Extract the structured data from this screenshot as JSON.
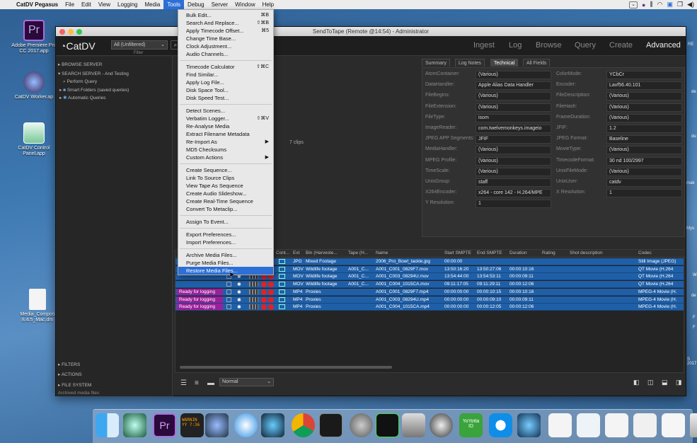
{
  "menubar": {
    "apple": "",
    "app": "CatDV Pegasus",
    "items": [
      "File",
      "Edit",
      "View",
      "Logging",
      "Media",
      "Tools",
      "Debug",
      "Server",
      "Window",
      "Help"
    ]
  },
  "desktop": {
    "icons": [
      {
        "label": "Adobe Premiere Pro CC 2017.app"
      },
      {
        "label": "CatDV Worker.ap"
      },
      {
        "label": "CatDV Control Panel.app"
      },
      {
        "label": "Media_Compos 8.4.5_Mac.dm"
      }
    ],
    "right_labels": [
      "RE",
      "de",
      "du",
      "mak",
      "Mys",
      "W",
      "de",
      "F",
      "F",
      "20",
      "S 2017"
    ]
  },
  "window": {
    "title": "SendToTape (Remote @14:54) - Administrator",
    "logo": "CatDV",
    "filter_value": "All (Unfiltered)",
    "filter_label": "Filter",
    "nav": [
      "Ingest",
      "Log",
      "Browse",
      "Query",
      "Create",
      "Advanced"
    ],
    "clips_count": "7 clips"
  },
  "sidebar": {
    "rows": [
      "BROWSE SERVER",
      "SEARCH SERVER - And Testing",
      "Perform Query",
      "Smart Folders (saved queries)",
      "Automatic Queries"
    ],
    "bottom": [
      "FILTERS",
      "ACTIONS",
      "FILE SYSTEM"
    ],
    "status": "Archived media files"
  },
  "details": {
    "tabs": [
      "Summary",
      "Log Notes",
      "Technical",
      "All Fields"
    ],
    "left": [
      [
        "AtomContainer:",
        "(Various)"
      ],
      [
        "DataHandler:",
        "Apple Alias Data Handler"
      ],
      [
        "FileBegins:",
        "(Various)"
      ],
      [
        "FileExtension:",
        "(Various)"
      ],
      [
        "FileType:",
        "isom"
      ],
      [
        "ImageReader:",
        "com.twelvemonkeys.imageio"
      ],
      [
        "JPEG APP Segments:",
        "JFIF"
      ],
      [
        "MediaHandler:",
        "(Various)"
      ],
      [
        "MPEG Profile:",
        "(Various)"
      ],
      [
        "TimeScale:",
        "(Various)"
      ],
      [
        "UnixGroup:",
        "staff"
      ],
      [
        "X264Encoder:",
        "x264 - core 142 - H.264/MPE"
      ],
      [
        "Y Resolution:",
        "1"
      ]
    ],
    "right": [
      [
        "ColorMode:",
        "YCbCr"
      ],
      [
        "Encoder:",
        "Lavf56.40.101"
      ],
      [
        "FileDescription:",
        "(Various)"
      ],
      [
        "FileHash:",
        "(Various)"
      ],
      [
        "FrameDuration:",
        "(Various)"
      ],
      [
        "JFIF:",
        "1.2"
      ],
      [
        "JPEG Format:",
        "Baseline"
      ],
      [
        "MovieType:",
        "(Various)"
      ],
      [
        "TimecodeFormat:",
        "30 nd 100/2997"
      ],
      [
        "UnixFileMode:",
        "(Various)"
      ],
      [
        "UnixUser:",
        "catdv"
      ],
      [
        "X Resolution:",
        "1"
      ]
    ]
  },
  "table": {
    "headers": [
      "Cont...",
      "Ext",
      "Bin (Harveste...",
      "Tape (H...",
      "Name",
      "Start SMPTE",
      "End SMPTE",
      "Duration",
      "Rating",
      "Shot description",
      "Codec"
    ],
    "rows": [
      {
        "status": "",
        "ext": "JPG",
        "bin": "Mixed Footage",
        "tape": "",
        "name": "2006_Pro_Bowl_tackle.jpg",
        "start": "00:00:00",
        "end": "",
        "dur": "",
        "codec": "Still Image (JPEG)"
      },
      {
        "status": "",
        "ext": "MOV",
        "bin": "Wildlife footage",
        "tape": "A001_C...",
        "name": "A001_C001_0829F7.mov",
        "start": "13:50:16:20",
        "end": "13:50:27:06",
        "dur": "00:00:10:16",
        "codec": "QT Movie (H.264"
      },
      {
        "status": "",
        "ext": "MOV",
        "bin": "Wildlife footage",
        "tape": "A001_C...",
        "name": "A001_C003_08294U.mov",
        "start": "13:54:44:00",
        "end": "13:54:53:11",
        "dur": "00:00:09:11",
        "codec": "QT Movie (H.264"
      },
      {
        "status": "",
        "ext": "MOV",
        "bin": "Wildlife footage",
        "tape": "A001_C...",
        "name": "A001_C004_1015CA.mov",
        "start": "09:11:17:05",
        "end": "09:11:29:11",
        "dur": "00:00:12:06",
        "codec": "QT Movie (H.264"
      },
      {
        "status": "Ready for logging",
        "ext": "MP4",
        "bin": "Proxies",
        "tape": "",
        "name": "A001_C001_0829F7.mp4",
        "start": "00:00:00:00",
        "end": "00:00:10:15",
        "dur": "00:00:10:16",
        "codec": "MPEG-4 Movie (H."
      },
      {
        "status": "Ready for logging",
        "ext": "MP4",
        "bin": "Proxies",
        "tape": "",
        "name": "A001_C003_08294U.mp4",
        "start": "00:00:00:00",
        "end": "00:00:09:10",
        "dur": "00:00:09:11",
        "codec": "MPEG-4 Movie (H."
      },
      {
        "status": "Ready for logging",
        "ext": "MP4",
        "bin": "Proxies",
        "tape": "",
        "name": "A001_C004_1015CA.mp4",
        "start": "00:00:00:00",
        "end": "00:00:12:05",
        "dur": "00:00:12:06",
        "codec": "MPEG-4 Movie (H."
      }
    ],
    "view_mode": "Normal"
  },
  "tools_menu": [
    {
      "label": "Bulk Edit...",
      "sc": "⌘B"
    },
    {
      "label": "Search And Replace...",
      "sc": "⇧⌘B"
    },
    {
      "label": "Apply Timecode Offset...",
      "sc": "⌘5"
    },
    {
      "label": "Change Time Base..."
    },
    {
      "label": "Clock Adjustment..."
    },
    {
      "label": "Audio Channels..."
    },
    {
      "sep": true
    },
    {
      "label": "Timecode Calculator",
      "sc": "⇧⌘C"
    },
    {
      "label": "Find Similar..."
    },
    {
      "label": "Apply Log File..."
    },
    {
      "label": "Disk Space Tool..."
    },
    {
      "label": "Disk Speed Test..."
    },
    {
      "sep": true
    },
    {
      "label": "Detect Scenes..."
    },
    {
      "label": "Verbatim Logger...",
      "sc": "⇧⌘V"
    },
    {
      "label": "Re-Analyse Media"
    },
    {
      "label": "Extract Filename Metadata"
    },
    {
      "label": "Re-Import As",
      "sub": "▶"
    },
    {
      "label": "MD5 Checksums"
    },
    {
      "label": "Custom Actions",
      "sub": "▶"
    },
    {
      "sep": true
    },
    {
      "label": "Create Sequence..."
    },
    {
      "label": "Link To Source Clips"
    },
    {
      "label": "View Tape As Sequence"
    },
    {
      "label": "Create Audio Slideshow..."
    },
    {
      "label": "Create Real-Time Sequence"
    },
    {
      "label": "Convert To Metaclip..."
    },
    {
      "sep": true
    },
    {
      "label": "Assign To Event..."
    },
    {
      "sep": true
    },
    {
      "label": "Export Preferences..."
    },
    {
      "label": "Import Preferences..."
    },
    {
      "sep": true
    },
    {
      "label": "Archive Media Files..."
    },
    {
      "label": "Purge Media Files..."
    },
    {
      "label": "Restore Media Files...",
      "hl": true
    }
  ],
  "dock": {
    "items": [
      "finder-icon",
      "catdv-worker-icon",
      "premiere-icon",
      "console-icon",
      "catdv-icon",
      "safari-icon",
      "catdv-pegasus-icon",
      "chrome-icon",
      "terminal-icon",
      "system-prefs-icon",
      "activity-icon",
      "disk-utility-icon",
      "davinci-icon",
      "yoyotta-icon",
      "teamviewer-icon",
      "catdv-control-icon",
      "doc1-icon",
      "doc2-icon",
      "doc3-icon",
      "doc4-icon",
      "doc5-icon",
      "trash-icon"
    ],
    "console_text": "WARNIN YY 7:36",
    "yoyotta_text": "YoYotta ID"
  }
}
